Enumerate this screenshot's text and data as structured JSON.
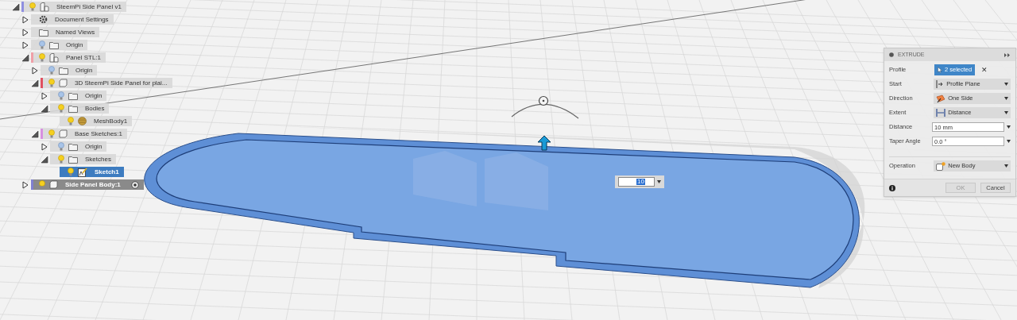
{
  "browser": {
    "items": [
      {
        "label": "SteemPi Side Panel v1",
        "kind": "component",
        "visible": true,
        "expanded": true,
        "selected": false,
        "color": "#8f8fe0",
        "children": [
          {
            "label": "Document Settings",
            "kind": "settings",
            "expanded": false,
            "selected": false
          },
          {
            "label": "Named Views",
            "kind": "folder",
            "expanded": false,
            "selected": false
          },
          {
            "label": "Origin",
            "kind": "folder",
            "visible": false,
            "expanded": false,
            "selected": false
          },
          {
            "label": "Panel STL:1",
            "kind": "component",
            "visible": true,
            "expanded": true,
            "selected": false,
            "color": "#f0a0a8",
            "children": [
              {
                "label": "Origin",
                "kind": "folder",
                "visible": false,
                "expanded": false,
                "selected": false
              },
              {
                "label": "3D SteemPi Side Panel for plai...",
                "kind": "body",
                "visible": true,
                "expanded": true,
                "selected": false,
                "color": "#e05060",
                "children": [
                  {
                    "label": "Origin",
                    "kind": "folder",
                    "visible": false,
                    "expanded": false,
                    "selected": false
                  },
                  {
                    "label": "Bodies",
                    "kind": "folder",
                    "visible": true,
                    "expanded": true,
                    "selected": false,
                    "children": [
                      {
                        "label": "MeshBody1",
                        "kind": "mesh",
                        "visible": true,
                        "selected": false
                      }
                    ]
                  }
                ]
              },
              {
                "label": "Base Sketches:1",
                "kind": "body",
                "visible": true,
                "expanded": true,
                "selected": false,
                "color": "#d890e0",
                "children": [
                  {
                    "label": "Origin",
                    "kind": "folder",
                    "visible": false,
                    "expanded": false,
                    "selected": false
                  },
                  {
                    "label": "Sketches",
                    "kind": "folder",
                    "visible": true,
                    "expanded": true,
                    "selected": false,
                    "children": [
                      {
                        "label": "Sketch1",
                        "kind": "sketch",
                        "visible": true,
                        "selected": true
                      }
                    ]
                  }
                ]
              }
            ]
          },
          {
            "label": "Side Panel Body:1",
            "kind": "body",
            "visible": true,
            "expanded": false,
            "selected": false,
            "color": "#8080d0",
            "dark": true
          }
        ]
      }
    ]
  },
  "viewport": {
    "distance_input": {
      "value": "10"
    }
  },
  "extrude_panel": {
    "title": "EXTRUDE",
    "rows": [
      {
        "label": "Profile",
        "kind": "selection",
        "value": "2 selected",
        "clear": "✕"
      },
      {
        "label": "Start",
        "kind": "dropdown",
        "value": "Profile Plane"
      },
      {
        "label": "Direction",
        "kind": "dropdown",
        "value": "One Side"
      },
      {
        "label": "Extent",
        "kind": "dropdown",
        "value": "Distance"
      },
      {
        "label": "Distance",
        "kind": "input",
        "value": "10 mm"
      },
      {
        "label": "Taper Angle",
        "kind": "input",
        "value": "0.0 °"
      },
      {
        "label": "Operation",
        "kind": "dropdown",
        "value": "New Body",
        "separated": true
      }
    ],
    "buttons": [
      {
        "label": "OK",
        "disabled": true
      },
      {
        "label": "Cancel",
        "disabled": false
      }
    ]
  }
}
